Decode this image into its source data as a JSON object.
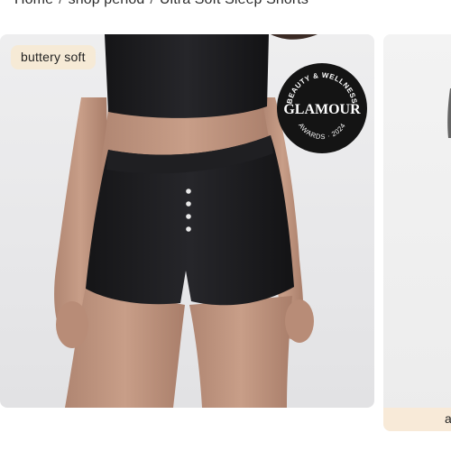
{
  "breadcrumb": {
    "items": [
      "Home",
      "shop period",
      "Ultra Soft Sleep Shorts"
    ],
    "separator": "/"
  },
  "product": {
    "image_alt": "Black ultra soft sleep shorts",
    "tag": "buttery soft",
    "award": {
      "top_arc": "BEAUTY & WELLNESS",
      "name": "GLAMOUR",
      "bottom_arc": "AWARDS · 2024"
    }
  },
  "next_card": {
    "tag_partial": "a"
  },
  "colors": {
    "tag_bg": "#f6ead6",
    "badge_bg": "#141414",
    "garment": "#1c1c1e",
    "skin": "#c49a83"
  }
}
